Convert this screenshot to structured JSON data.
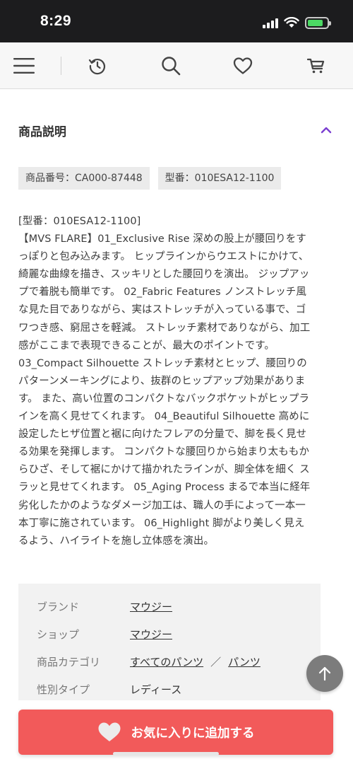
{
  "status": {
    "time": "8:29"
  },
  "header": {
    "icons": [
      "menu-icon",
      "history-icon",
      "search-icon",
      "heart-icon",
      "cart-icon"
    ]
  },
  "section": {
    "title": "商品説明"
  },
  "tags": [
    {
      "text": "商品番号：CA000-87448"
    },
    {
      "text": "型番：010ESA12-1100"
    }
  ],
  "description": [
    "[型番：010ESA12-1100]",
    "【MVS FLARE】01_Exclusive Rise 深めの股上が腰回りをす",
    "っぽりと包み込みます。 ヒップラインからウエストにかけて、",
    "綺麗な曲線を描き、スッキリとした腰回りを演出。 ジップアッ",
    "プで着脱も簡単です。 02_Fabric Features ノンストレッチ風",
    "な見た目でありながら、実はストレッチが入っている事で、ゴ",
    "ワつき感、窮屈さを軽減。 ストレッチ素材でありながら、加工",
    "感がここまで表現できることが、最大のポイントです。",
    "03_Compact Silhouette ストレッチ素材とヒップ、腰回りの",
    "パターンメーキングにより、抜群のヒップアップ効果がありま",
    "す。 また、高い位置のコンパクトなバックポケットがヒップラ",
    "インを高く見せてくれます。 04_Beautiful Silhouette 高めに",
    "設定したヒザ位置と裾に向けたフレアの分量で、脚を長く見せ",
    "る効果を発揮します。 コンパクトな腰回りから始まり太ももか",
    "らひざ、そして裾にかけて描かれたラインが、脚全体を細く ス",
    "ラッと見せてくれます。 05_Aging Process まるで本当に経年",
    "劣化したかのようなダメージ加工は、職人の手によって一本一",
    "本丁寧に施されています。 06_Highlight 脚がより美しく見え",
    "るよう、ハイライトを施し立体感を演出。"
  ],
  "info": {
    "brand_label": "ブランド",
    "brand_value": "マウジー",
    "shop_label": "ショップ",
    "shop_value": "マウジー",
    "category_label": "商品カテゴリ",
    "category_1": "すべてのパンツ",
    "category_sep": "／",
    "category_2": "パンツ",
    "gender_label": "性別タイプ",
    "gender_value": "レディース"
  },
  "favorite_button": {
    "label": "お気に入りに追加する"
  },
  "colors": {
    "accent": "#f25a5a",
    "chevron": "#7b3fd1",
    "scroll_button": "#7c7c7c"
  }
}
